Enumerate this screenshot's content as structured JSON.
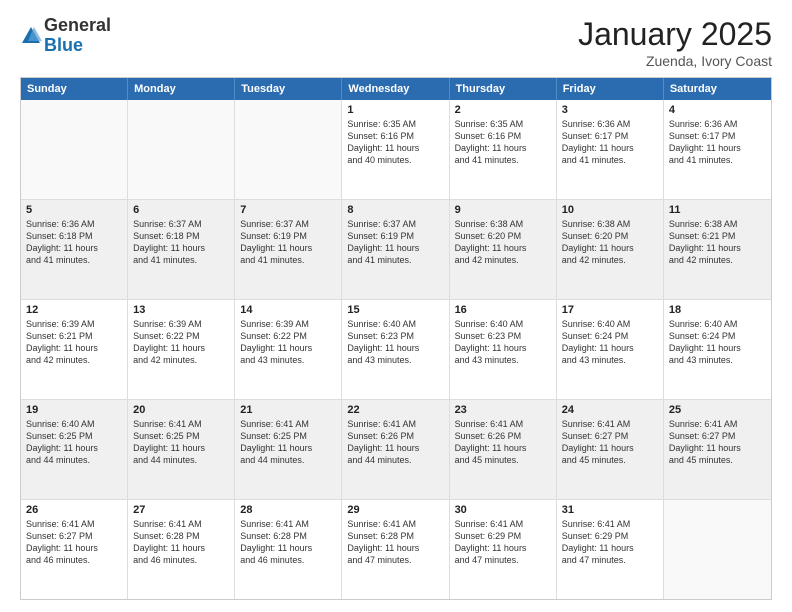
{
  "logo": {
    "general": "General",
    "blue": "Blue"
  },
  "title": "January 2025",
  "location": "Zuenda, Ivory Coast",
  "header_days": [
    "Sunday",
    "Monday",
    "Tuesday",
    "Wednesday",
    "Thursday",
    "Friday",
    "Saturday"
  ],
  "rows": [
    [
      {
        "day": "",
        "empty": true
      },
      {
        "day": "",
        "empty": true
      },
      {
        "day": "",
        "empty": true
      },
      {
        "day": "1",
        "lines": [
          "Sunrise: 6:35 AM",
          "Sunset: 6:16 PM",
          "Daylight: 11 hours",
          "and 40 minutes."
        ]
      },
      {
        "day": "2",
        "lines": [
          "Sunrise: 6:35 AM",
          "Sunset: 6:16 PM",
          "Daylight: 11 hours",
          "and 41 minutes."
        ]
      },
      {
        "day": "3",
        "lines": [
          "Sunrise: 6:36 AM",
          "Sunset: 6:17 PM",
          "Daylight: 11 hours",
          "and 41 minutes."
        ]
      },
      {
        "day": "4",
        "lines": [
          "Sunrise: 6:36 AM",
          "Sunset: 6:17 PM",
          "Daylight: 11 hours",
          "and 41 minutes."
        ]
      }
    ],
    [
      {
        "day": "5",
        "lines": [
          "Sunrise: 6:36 AM",
          "Sunset: 6:18 PM",
          "Daylight: 11 hours",
          "and 41 minutes."
        ]
      },
      {
        "day": "6",
        "lines": [
          "Sunrise: 6:37 AM",
          "Sunset: 6:18 PM",
          "Daylight: 11 hours",
          "and 41 minutes."
        ]
      },
      {
        "day": "7",
        "lines": [
          "Sunrise: 6:37 AM",
          "Sunset: 6:19 PM",
          "Daylight: 11 hours",
          "and 41 minutes."
        ]
      },
      {
        "day": "8",
        "lines": [
          "Sunrise: 6:37 AM",
          "Sunset: 6:19 PM",
          "Daylight: 11 hours",
          "and 41 minutes."
        ]
      },
      {
        "day": "9",
        "lines": [
          "Sunrise: 6:38 AM",
          "Sunset: 6:20 PM",
          "Daylight: 11 hours",
          "and 42 minutes."
        ]
      },
      {
        "day": "10",
        "lines": [
          "Sunrise: 6:38 AM",
          "Sunset: 6:20 PM",
          "Daylight: 11 hours",
          "and 42 minutes."
        ]
      },
      {
        "day": "11",
        "lines": [
          "Sunrise: 6:38 AM",
          "Sunset: 6:21 PM",
          "Daylight: 11 hours",
          "and 42 minutes."
        ]
      }
    ],
    [
      {
        "day": "12",
        "lines": [
          "Sunrise: 6:39 AM",
          "Sunset: 6:21 PM",
          "Daylight: 11 hours",
          "and 42 minutes."
        ]
      },
      {
        "day": "13",
        "lines": [
          "Sunrise: 6:39 AM",
          "Sunset: 6:22 PM",
          "Daylight: 11 hours",
          "and 42 minutes."
        ]
      },
      {
        "day": "14",
        "lines": [
          "Sunrise: 6:39 AM",
          "Sunset: 6:22 PM",
          "Daylight: 11 hours",
          "and 43 minutes."
        ]
      },
      {
        "day": "15",
        "lines": [
          "Sunrise: 6:40 AM",
          "Sunset: 6:23 PM",
          "Daylight: 11 hours",
          "and 43 minutes."
        ]
      },
      {
        "day": "16",
        "lines": [
          "Sunrise: 6:40 AM",
          "Sunset: 6:23 PM",
          "Daylight: 11 hours",
          "and 43 minutes."
        ]
      },
      {
        "day": "17",
        "lines": [
          "Sunrise: 6:40 AM",
          "Sunset: 6:24 PM",
          "Daylight: 11 hours",
          "and 43 minutes."
        ]
      },
      {
        "day": "18",
        "lines": [
          "Sunrise: 6:40 AM",
          "Sunset: 6:24 PM",
          "Daylight: 11 hours",
          "and 43 minutes."
        ]
      }
    ],
    [
      {
        "day": "19",
        "lines": [
          "Sunrise: 6:40 AM",
          "Sunset: 6:25 PM",
          "Daylight: 11 hours",
          "and 44 minutes."
        ]
      },
      {
        "day": "20",
        "lines": [
          "Sunrise: 6:41 AM",
          "Sunset: 6:25 PM",
          "Daylight: 11 hours",
          "and 44 minutes."
        ]
      },
      {
        "day": "21",
        "lines": [
          "Sunrise: 6:41 AM",
          "Sunset: 6:25 PM",
          "Daylight: 11 hours",
          "and 44 minutes."
        ]
      },
      {
        "day": "22",
        "lines": [
          "Sunrise: 6:41 AM",
          "Sunset: 6:26 PM",
          "Daylight: 11 hours",
          "and 44 minutes."
        ]
      },
      {
        "day": "23",
        "lines": [
          "Sunrise: 6:41 AM",
          "Sunset: 6:26 PM",
          "Daylight: 11 hours",
          "and 45 minutes."
        ]
      },
      {
        "day": "24",
        "lines": [
          "Sunrise: 6:41 AM",
          "Sunset: 6:27 PM",
          "Daylight: 11 hours",
          "and 45 minutes."
        ]
      },
      {
        "day": "25",
        "lines": [
          "Sunrise: 6:41 AM",
          "Sunset: 6:27 PM",
          "Daylight: 11 hours",
          "and 45 minutes."
        ]
      }
    ],
    [
      {
        "day": "26",
        "lines": [
          "Sunrise: 6:41 AM",
          "Sunset: 6:27 PM",
          "Daylight: 11 hours",
          "and 46 minutes."
        ]
      },
      {
        "day": "27",
        "lines": [
          "Sunrise: 6:41 AM",
          "Sunset: 6:28 PM",
          "Daylight: 11 hours",
          "and 46 minutes."
        ]
      },
      {
        "day": "28",
        "lines": [
          "Sunrise: 6:41 AM",
          "Sunset: 6:28 PM",
          "Daylight: 11 hours",
          "and 46 minutes."
        ]
      },
      {
        "day": "29",
        "lines": [
          "Sunrise: 6:41 AM",
          "Sunset: 6:28 PM",
          "Daylight: 11 hours",
          "and 47 minutes."
        ]
      },
      {
        "day": "30",
        "lines": [
          "Sunrise: 6:41 AM",
          "Sunset: 6:29 PM",
          "Daylight: 11 hours",
          "and 47 minutes."
        ]
      },
      {
        "day": "31",
        "lines": [
          "Sunrise: 6:41 AM",
          "Sunset: 6:29 PM",
          "Daylight: 11 hours",
          "and 47 minutes."
        ]
      },
      {
        "day": "",
        "empty": true
      }
    ]
  ]
}
